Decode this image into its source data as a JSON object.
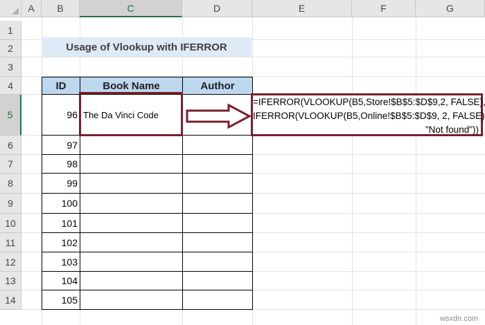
{
  "sheet": {
    "columns": [
      "A",
      "B",
      "C",
      "D",
      "E",
      "F",
      "G"
    ],
    "selected_column": "C",
    "rows": [
      "1",
      "2",
      "3",
      "4",
      "5",
      "6",
      "7",
      "8",
      "9",
      "10",
      "11",
      "12",
      "13",
      "14"
    ],
    "selected_row": "5"
  },
  "title": "Usage of Vlookup with IFERROR",
  "table": {
    "headers": [
      "ID",
      "Book Name",
      "Author"
    ],
    "rows": [
      {
        "id": "96",
        "book": "The Da Vinci Code",
        "author": ""
      },
      {
        "id": "97",
        "book": "",
        "author": ""
      },
      {
        "id": "98",
        "book": "",
        "author": ""
      },
      {
        "id": "99",
        "book": "",
        "author": ""
      },
      {
        "id": "100",
        "book": "",
        "author": ""
      },
      {
        "id": "101",
        "book": "",
        "author": ""
      },
      {
        "id": "102",
        "book": "",
        "author": ""
      },
      {
        "id": "103",
        "book": "",
        "author": ""
      },
      {
        "id": "104",
        "book": "",
        "author": ""
      },
      {
        "id": "105",
        "book": "",
        "author": ""
      }
    ]
  },
  "formula": {
    "line1": "=IFERROR(VLOOKUP(B5,Store!$B$5:$D$9,2, FALSE),",
    "line2": "IFERROR(VLOOKUP(B5,Online!$B$5:$D$9, 2, FALSE),",
    "line3": "\"Not found\"))"
  },
  "watermark": "wsxdn.com",
  "colors": {
    "highlight_border": "#7b1f2a",
    "header_fill": "#bdd7ee",
    "title_fill": "#deeaf6"
  }
}
